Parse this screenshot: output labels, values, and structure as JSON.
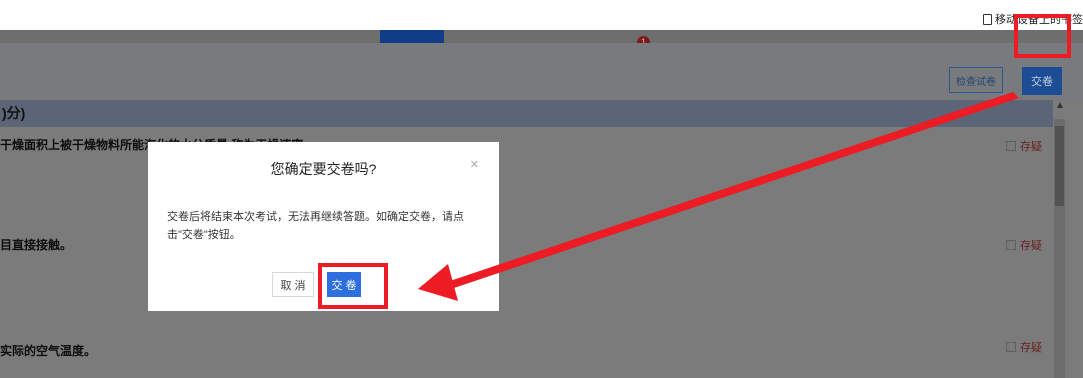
{
  "bookmarks": {
    "mobile_label": "移动设备上的书签"
  },
  "toolbar": {
    "check_label": "检查试卷",
    "submit_label": "交卷"
  },
  "nav": {
    "badge": "1"
  },
  "section": {
    "title": ")分)"
  },
  "questions": [
    {
      "text": "干燥面积上被干燥物料所能汽化的水分质量,称为干燥速率。",
      "doubt": "存疑"
    },
    {
      "text": "目直接接触。",
      "doubt": "存疑"
    },
    {
      "text": "实际的空气温度。",
      "doubt": "存疑"
    }
  ],
  "modal": {
    "title": "您确定要交卷吗?",
    "close": "×",
    "body": "交卷后将结束本次考试，无法再继续答题。如确定交卷，请点击\"交卷\"按钮。",
    "cancel_label": "取 消",
    "submit_label": "交 卷"
  },
  "colors": {
    "annotation_red": "#ec1b24",
    "primary_blue": "#2e6fe0"
  }
}
